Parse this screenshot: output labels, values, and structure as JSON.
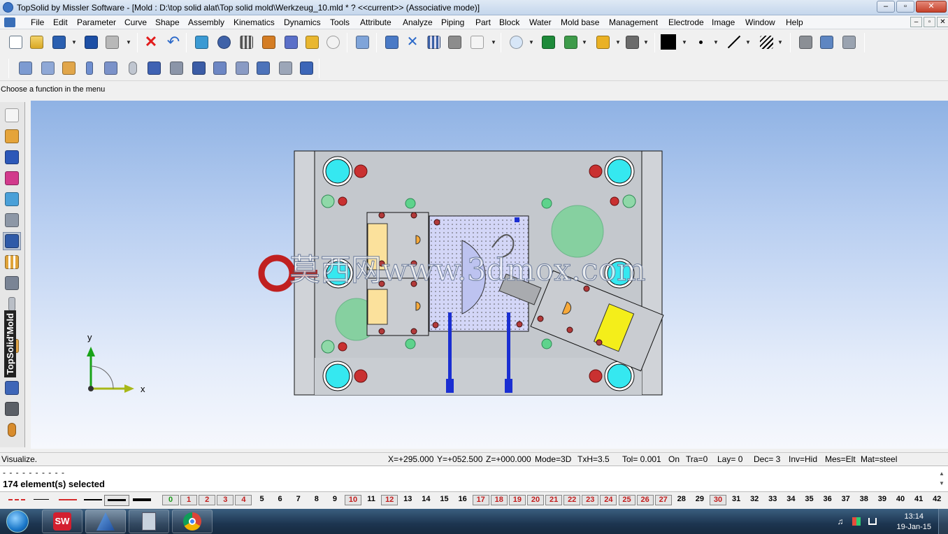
{
  "window": {
    "title": "TopSolid by Missler Software - [Mold : D:\\top solid alat\\Top solid mold\\Werkzeug_10.mld * ?  <<current>> (Associative mode)]",
    "min": "–",
    "max": "▫",
    "close": "✕"
  },
  "menu": {
    "items": [
      "File",
      "Edit",
      "Parameter",
      "Curve",
      "Shape",
      "Assembly",
      "Kinematics",
      "Dynamics",
      "Tools",
      "Attribute",
      "Analyze",
      "Piping",
      "Part",
      "Block",
      "Water",
      "Mold base",
      "Management",
      "Electrode",
      "Image",
      "Window",
      "Help"
    ],
    "mdi": [
      "–",
      "▫",
      "✕"
    ]
  },
  "toolbar1": {
    "icons": [
      "new-file-icon",
      "open-folder-icon",
      "save-icon",
      "info-icon",
      "print-icon",
      "delete-icon",
      "undo-icon",
      "refresh-icon",
      "redraw-icon",
      "settings-sliders-icon",
      "hammer-icon",
      "wrench-icon",
      "brush-icon",
      "eye-icon",
      "cut-icon",
      "pick-icon",
      "trim-icon",
      "filter-icon",
      "magnet-icon",
      "pencil-icon",
      "zoom-icon",
      "fit-view-icon",
      "view-icon",
      "render-icon",
      "printer-icon",
      "color-swatch-icon",
      "point-style-icon",
      "line-style-icon",
      "hatch-icon",
      "camera-icon",
      "scanner-icon",
      "3d-view-icon"
    ],
    "accent_colors": [
      "#e21b1b",
      "#2a68c9",
      "#eab124",
      "#1e8a3a",
      "#000000"
    ]
  },
  "toolbar2": {
    "icons": [
      "slab-icon",
      "block-icon",
      "box-icon",
      "pin-icon",
      "stack-icon",
      "cylinder-icon",
      "cube-icon",
      "plate-icon",
      "cube2-icon",
      "ejector-icon",
      "assembly-icon",
      "slider-icon",
      "lifter-icon",
      "cooling-icon"
    ]
  },
  "prompt": "Choose a function in the menu",
  "side_toolbar": {
    "icons": [
      "sketch-icon",
      "curve-icon",
      "solid-icon",
      "surface-icon",
      "mold-icon",
      "shape-icon",
      "block-icon",
      "bars-icon",
      "plate-icon",
      "tower-icon",
      "insert-icon",
      "ejector-icon",
      "part-icon",
      "bolt-icon",
      "stack-icon",
      "drop-icon"
    ],
    "brand": "TopSolid'Mold"
  },
  "drawing": {
    "axis_x": "x",
    "axis_y": "y",
    "watermark": "莫西网www.3dmox.com",
    "colors": {
      "plate": "#c7ccd1",
      "holes": "#35e8f0",
      "bolt": "#c93131",
      "slide": "#fbe19c",
      "yellow": "#f4ee1a",
      "cavity": "#d3d6f7",
      "rod": "#1a2ed2",
      "green": "#5ed38c"
    }
  },
  "status": {
    "label": "Visualize.",
    "fields": [
      "X=+295.000",
      "Y=+052.500",
      "Z=+000.000",
      "Mode=3D",
      "TxH=3.5",
      "Tol= 0.001",
      "On",
      "Tra=0",
      "Lay=  0",
      "Dec= 3",
      "Inv=Hid",
      "Mes=Elt",
      "Mat=steel"
    ]
  },
  "message": {
    "line1": "- - - - - - - - - -",
    "line2": "174 element(s) selected",
    "scroll_up": "▲",
    "scroll_down": "▼"
  },
  "layers": {
    "boxed": [
      "0",
      "1",
      "2",
      "3",
      "4",
      "10",
      "12",
      "17",
      "18",
      "19",
      "20",
      "21",
      "22",
      "23",
      "24",
      "25",
      "26",
      "27",
      "30"
    ],
    "numbers": [
      "0",
      "1",
      "2",
      "3",
      "4",
      "5",
      "6",
      "7",
      "8",
      "9",
      "10",
      "11",
      "12",
      "13",
      "14",
      "15",
      "16",
      "17",
      "18",
      "19",
      "20",
      "21",
      "22",
      "23",
      "24",
      "25",
      "26",
      "27",
      "28",
      "29",
      "30",
      "31",
      "32",
      "33",
      "34",
      "35",
      "36",
      "37",
      "38",
      "39",
      "40",
      "41",
      "42"
    ],
    "line_types": [
      "dash-red",
      "solid-thin",
      "solid-red",
      "solid-medium",
      "solid-thick-boxed",
      "solid-thicker"
    ]
  },
  "taskbar": {
    "apps": [
      "solidworks-icon",
      "catia-icon",
      "calculator-icon",
      "chrome-icon"
    ],
    "tray": [
      "speaker-icon",
      "flag-icon",
      "network-icon"
    ],
    "time": "13:14",
    "date": "19-Jan-15"
  }
}
